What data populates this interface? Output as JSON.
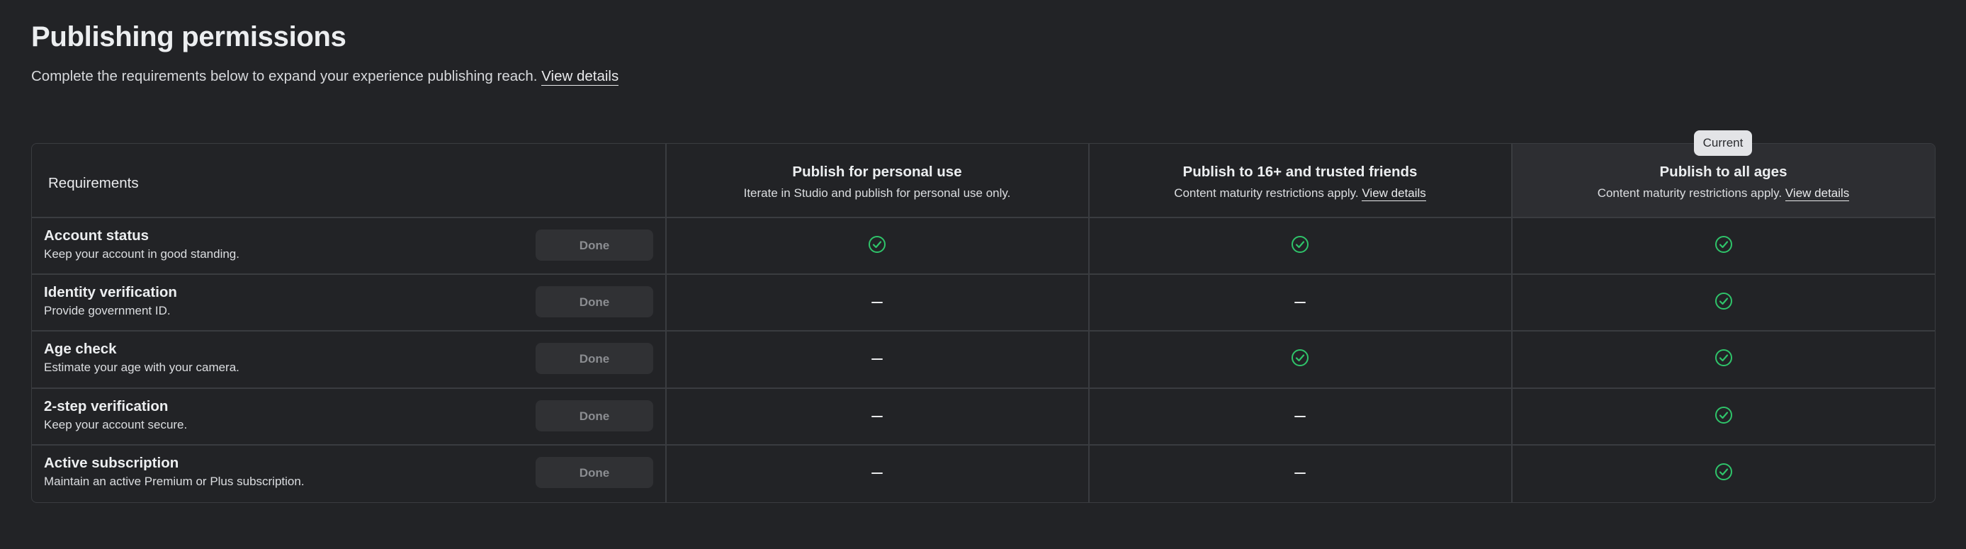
{
  "page": {
    "title": "Publishing permissions",
    "subtitle": "Complete the requirements below to expand your experience publishing reach.",
    "subtitle_link": "View details"
  },
  "table": {
    "requirements_header": "Requirements",
    "current_badge": "Current",
    "columns": [
      {
        "title": "Publish for personal use",
        "subtitle": "Iterate in Studio and publish for personal use only.",
        "link": ""
      },
      {
        "title": "Publish to 16+ and trusted friends",
        "subtitle": "Content maturity restrictions apply.",
        "link": "View details"
      },
      {
        "title": "Publish to all ages",
        "subtitle": "Content maturity restrictions apply.",
        "link": "View details"
      }
    ],
    "rows": [
      {
        "name": "Account status",
        "description": "Keep your account in good standing.",
        "button": "Done",
        "cells": [
          "check",
          "check",
          "check"
        ]
      },
      {
        "name": "Identity verification",
        "description": "Provide government ID.",
        "button": "Done",
        "cells": [
          "dash",
          "dash",
          "check"
        ]
      },
      {
        "name": "Age check",
        "description": "Estimate your age with your camera.",
        "button": "Done",
        "cells": [
          "dash",
          "check",
          "check"
        ]
      },
      {
        "name": "2-step verification",
        "description": "Keep your account secure.",
        "button": "Done",
        "cells": [
          "dash",
          "dash",
          "check"
        ]
      },
      {
        "name": "Active subscription",
        "description": "Maintain an active Premium or Plus subscription.",
        "button": "Done",
        "cells": [
          "dash",
          "dash",
          "check"
        ]
      }
    ]
  },
  "colors": {
    "background": "#222326",
    "check": "#2fc46a",
    "border": "#3a3c40",
    "current_column": "#2d2e32"
  },
  "icons": {
    "check": "check-circle-icon",
    "dash": "dash-icon"
  }
}
